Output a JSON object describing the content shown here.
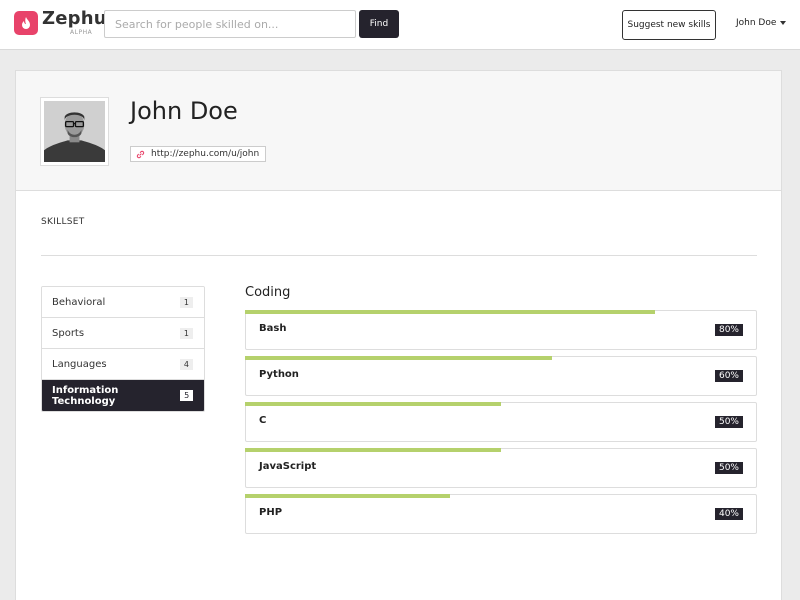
{
  "header": {
    "brand": "Zephu",
    "brand_tag": "ALPHA",
    "search_placeholder": "Search for people skilled on...",
    "find_label": "Find",
    "suggest_label": "Suggest new skills",
    "user_name": "John Doe"
  },
  "profile": {
    "name": "John Doe",
    "url": "http://zephu.com/u/john"
  },
  "skillset": {
    "title": "SKILLSET",
    "categories": [
      {
        "label": "Behavioral",
        "count": "1"
      },
      {
        "label": "Sports",
        "count": "1"
      },
      {
        "label": "Languages",
        "count": "4"
      },
      {
        "label": "Information Technology",
        "count": "5"
      }
    ],
    "active_category_index": 3,
    "group_title": "Coding",
    "skills": [
      {
        "name": "Bash",
        "percent_label": "80%",
        "level": 0.8
      },
      {
        "name": "Python",
        "percent_label": "60%",
        "level": 0.6
      },
      {
        "name": "C",
        "percent_label": "50%",
        "level": 0.5
      },
      {
        "name": "JavaScript",
        "percent_label": "50%",
        "level": 0.5
      },
      {
        "name": "PHP",
        "percent_label": "40%",
        "level": 0.4
      }
    ]
  },
  "colors": {
    "brand": "#e8436a",
    "dark": "#25232d",
    "skill_bar": "#b5d16c"
  },
  "icons": {
    "logo": "flame-icon",
    "link": "link-icon",
    "user_menu": "caret-down-icon"
  }
}
